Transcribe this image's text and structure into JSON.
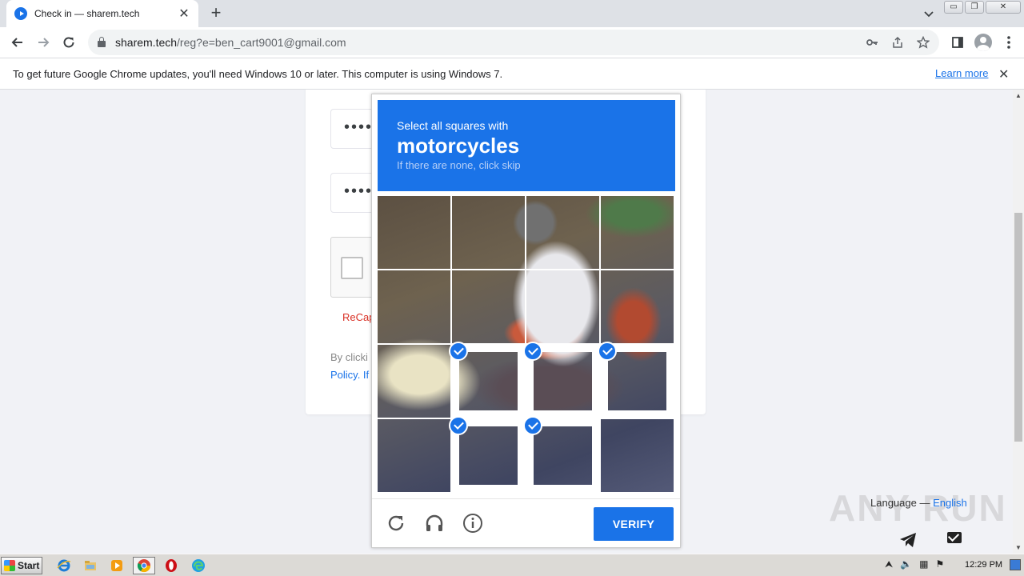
{
  "browser": {
    "tab": {
      "title": "Check in — sharem.tech",
      "close": "✕"
    },
    "new_tab": "+",
    "url_host": "sharem.tech",
    "url_path": "/reg?e=ben_cart9001@gmail.com",
    "window_controls": {
      "minimize": "▭",
      "restore": "❐",
      "close": "✕"
    }
  },
  "infobar": {
    "message": "To get future Google Chrome updates, you'll need Windows 10 or later. This computer is using Windows 7.",
    "learn_more": "Learn more",
    "close": "✕"
  },
  "page": {
    "password_mask_1": "•••••",
    "password_mask_2": "•••••",
    "recaptcha_label": "ReCap",
    "consent_text": "By clicki",
    "policy_text": "Policy. If",
    "language_label": "Language — ",
    "language_value": "English",
    "watermark": "ANY RUN"
  },
  "captcha": {
    "instruction": "Select all squares with",
    "target": "motorcycles",
    "hint": "If there are none, click skip",
    "selected": [
      9,
      10,
      11,
      13,
      14
    ],
    "verify_label": "VERIFY",
    "footer_icons": [
      "reload-icon",
      "headphones-icon",
      "info-icon"
    ]
  },
  "taskbar": {
    "start_label": "Start",
    "apps": [
      "ie-icon",
      "explorer-icon",
      "media-player-icon",
      "chrome-icon",
      "opera-icon",
      "edge-icon"
    ],
    "active_app": "chrome-icon",
    "clock": "12:29 PM"
  },
  "colors": {
    "accent": "#1a73e8",
    "captcha_header": "#1a73e8",
    "recaptcha_error": "#d93025"
  }
}
